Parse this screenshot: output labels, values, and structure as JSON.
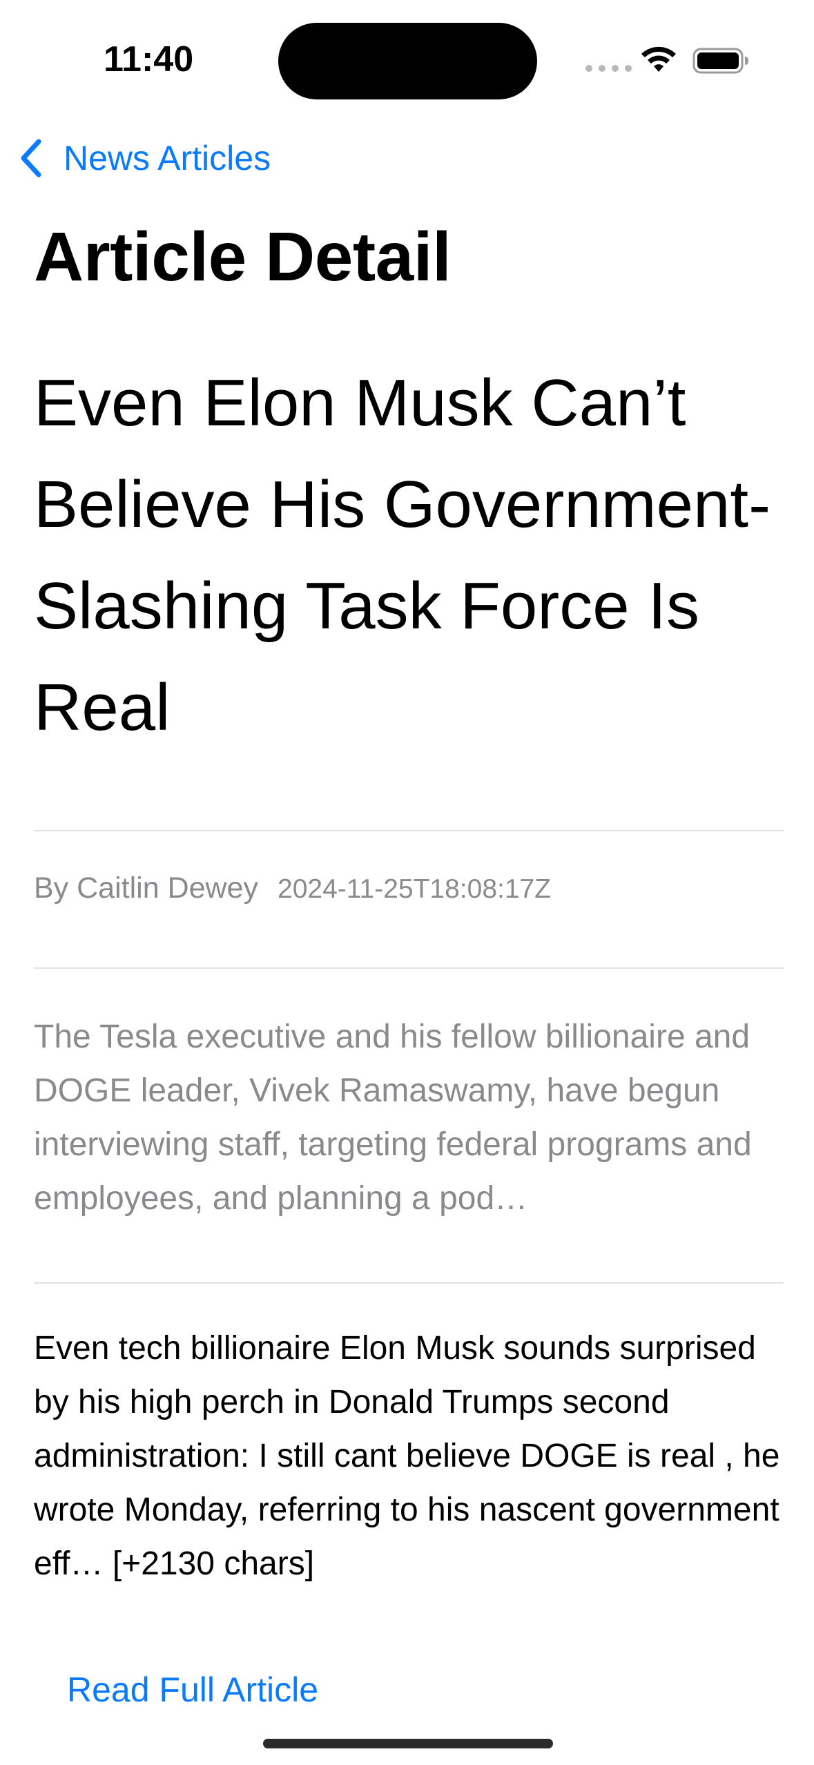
{
  "status_bar": {
    "time": "11:40"
  },
  "nav": {
    "back_label": "News Articles"
  },
  "page": {
    "title": "Article Detail"
  },
  "article": {
    "headline": "Even Elon Musk Can’t Believe His Government-Slashing Task Force Is Real",
    "author": "By Caitlin Dewey",
    "published_at": "2024-11-25T18:08:17Z",
    "summary": "The Tesla executive and his fellow billionaire and DOGE leader, Vivek Ramaswamy, have begun interviewing staff, targeting federal programs and employees, and planning a pod…",
    "content": "Even tech billionaire Elon Musk sounds surprised by his high perch in Donald Trumps second administration: I still cant believe DOGE is real , he wrote Monday, referring to his nascent government eff… [+2130 chars]",
    "read_full_label": "Read Full Article"
  },
  "icons": {
    "back": "chevron-left-icon",
    "wifi": "wifi-icon",
    "battery": "battery-icon",
    "signal": "cellular-signal-icon"
  },
  "colors": {
    "accent": "#0a7aff",
    "secondary_text": "#8a8a8e",
    "divider": "#e1e1e4"
  }
}
